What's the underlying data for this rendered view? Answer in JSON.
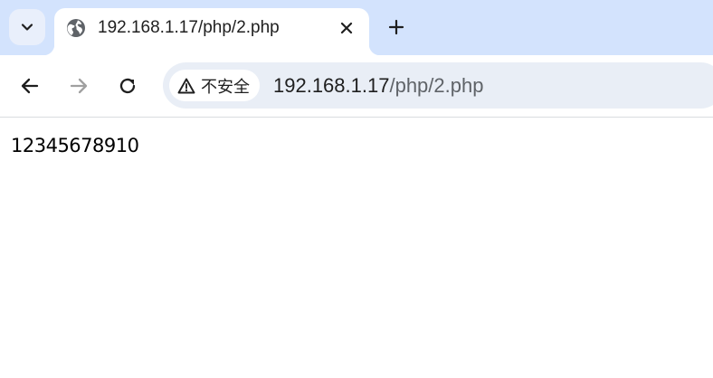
{
  "tab": {
    "title": "192.168.1.17/php/2.php"
  },
  "omnibox": {
    "security_label": "不安全",
    "url_host": "192.168.1.17",
    "url_path": "/php/2.php"
  },
  "page": {
    "text": "12345678910"
  },
  "icons": {
    "tab_search": "chevron-down-icon",
    "favicon": "globe-icon",
    "tab_close": "close-icon",
    "new_tab": "plus-icon",
    "back": "arrow-left-icon",
    "forward": "arrow-right-icon",
    "reload": "reload-icon",
    "security": "warning-triangle-icon"
  },
  "colors": {
    "tabstrip_bg": "#d3e3fd",
    "omnibox_bg": "#e9eef6",
    "forward_disabled": "#a0a0a0"
  }
}
